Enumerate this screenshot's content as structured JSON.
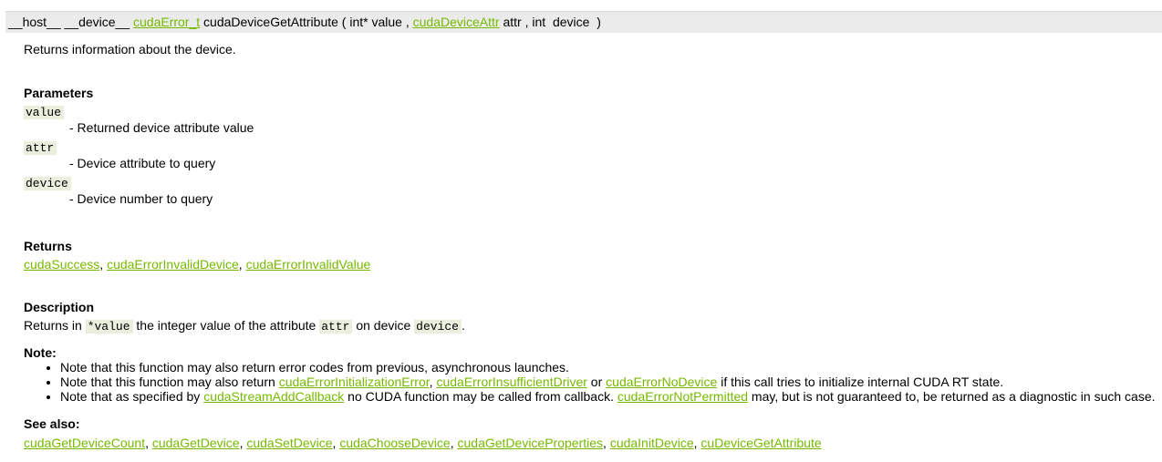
{
  "signature": {
    "qualifiers": "__host__ __device__",
    "return_type": "cudaError_t",
    "function_name": "cudaDeviceGetAttribute",
    "open_paren": "(",
    "param1_type": "int*",
    "param1_name": "value",
    "comma1": ",",
    "param2_type": "cudaDeviceAttr",
    "param2_name": "attr",
    "comma2": ",",
    "param3_type": "int",
    "param3_name": "device",
    "close_paren": ")"
  },
  "brief": "Returns information about the device.",
  "parameters": {
    "title": "Parameters",
    "items": [
      {
        "name": "value",
        "desc": "- Returned device attribute value"
      },
      {
        "name": "attr",
        "desc": "- Device attribute to query"
      },
      {
        "name": "device",
        "desc": "- Device number to query"
      }
    ]
  },
  "returns": {
    "title": "Returns",
    "links": [
      "cudaSuccess",
      "cudaErrorInvalidDevice",
      "cudaErrorInvalidValue"
    ],
    "separator": ", "
  },
  "description": {
    "title": "Description",
    "part1": "Returns in ",
    "code1": "*value",
    "part2": " the integer value of the attribute ",
    "code2": "attr",
    "part3": " on device ",
    "code3": "device",
    "part4": "."
  },
  "note": {
    "title": "Note:",
    "item1": "Note that this function may also return error codes from previous, asynchronous launches.",
    "item2_a": "Note that this function may also return ",
    "item2_link1": "cudaErrorInitializationError",
    "item2_b": ", ",
    "item2_link2": "cudaErrorInsufficientDriver",
    "item2_c": " or ",
    "item2_link3": "cudaErrorNoDevice",
    "item2_d": " if this call tries to initialize internal CUDA RT state.",
    "item3_a": "Note that as specified by ",
    "item3_link1": "cudaStreamAddCallback",
    "item3_b": " no CUDA function may be called from callback. ",
    "item3_link2": "cudaErrorNotPermitted",
    "item3_c": " may, but is not guaranteed to, be returned as a diagnostic in such case."
  },
  "see_also": {
    "title": "See also:",
    "links": [
      "cudaGetDeviceCount",
      "cudaGetDevice",
      "cudaSetDevice",
      "cudaChooseDevice",
      "cudaGetDeviceProperties",
      "cudaInitDevice",
      "cuDeviceGetAttribute"
    ],
    "separator": ", "
  },
  "colors": {
    "link": "#76b900",
    "signature_bg": "#ebebeb",
    "code_bg": "#e9eedd"
  }
}
